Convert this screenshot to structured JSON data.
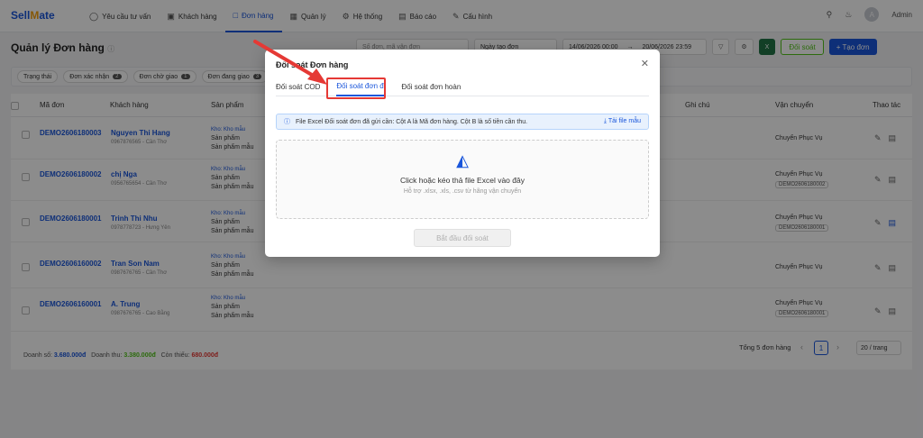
{
  "brand": {
    "logo_a": "Sell",
    "logo_b": "M",
    "logo_c": "ate"
  },
  "nav": [
    {
      "label": "Yêu cầu tư vấn",
      "icon": "chat-icon"
    },
    {
      "label": "Khách hàng",
      "icon": "users-icon"
    },
    {
      "label": "Đơn hàng",
      "icon": "cart-icon",
      "active": true
    },
    {
      "label": "Quản lý",
      "icon": "grid-icon"
    },
    {
      "label": "Hệ thống",
      "icon": "gear-icon"
    },
    {
      "label": "Báo cáo",
      "icon": "report-icon"
    },
    {
      "label": "Cấu hình",
      "icon": "wrench-icon"
    }
  ],
  "user": {
    "name": "Admin",
    "initial": "A"
  },
  "page": {
    "title": "Quản lý Đơn hàng"
  },
  "toolbar": {
    "search_placeholder": "Số đơn, mã vận đơn",
    "date_type": "Ngày tạo đơn",
    "date_from": "14/06/2026 00:00",
    "date_to": "20/06/2026 23:59",
    "reconcile": "Đối soát",
    "create": "+ Tạo đơn"
  },
  "filters": [
    {
      "label": "Trạng thái"
    },
    {
      "label": "Đơn xác nhận",
      "count": "2"
    },
    {
      "label": "Đơn chờ giao",
      "count": "1"
    },
    {
      "label": "Đơn đang giao",
      "count": "3"
    }
  ],
  "table": {
    "headers": {
      "code": "Mã đơn",
      "customer": "Khách hàng",
      "product": "Sản phẩm",
      "note": "Ghi chú",
      "shipping": "Vận chuyển",
      "actions": "Thao tác"
    },
    "rows": [
      {
        "code": "DEMO2606180003",
        "customer": "Nguyen Thi Hang",
        "phone": "0967876565 - Cần Thơ",
        "p1": "Kho: Kho mẫu",
        "p2": "Sản phẩm",
        "p3": "Sản phẩm mẫu",
        "ship": "Chuyển Phục Vụ",
        "tracking": ""
      },
      {
        "code": "DEMO2606180002",
        "customer": "chị Nga",
        "phone": "0956765654 - Cần Thơ",
        "p1": "Kho: Kho mẫu",
        "p2": "Sản phẩm",
        "p3": "Sản phẩm mẫu",
        "ship": "Chuyển Phục Vụ",
        "tracking": "DEMO2606180002"
      },
      {
        "code": "DEMO2606180001",
        "customer": "Trinh Thi Nhu",
        "phone": "0978778723 - Hưng Yên",
        "p1": "Kho: Kho mẫu",
        "p2": "Sản phẩm",
        "p3": "Sản phẩm mẫu",
        "ship": "Chuyển Phục Vụ",
        "tracking": "DEMO2606180001"
      },
      {
        "code": "DEMO2606160002",
        "customer": "Tran Son Nam",
        "phone": "0987676765 - Cần Thơ",
        "p1": "Kho: Kho mẫu",
        "p2": "Sản phẩm",
        "p3": "Sản phẩm mẫu",
        "ship": "Chuyển Phục Vụ",
        "tracking": ""
      },
      {
        "code": "DEMO2606160001",
        "customer": "A. Trung",
        "phone": "0987676765 - Cao Bằng",
        "p1": "Kho: Kho mẫu",
        "p2": "Sản phẩm",
        "p3": "Sản phẩm mẫu",
        "ship": "Chuyển Phục Vụ",
        "tracking": "DEMO2606180001"
      }
    ]
  },
  "footer": {
    "revenue_label": "Doanh số:",
    "revenue": "3.680.000đ",
    "income_label": "Doanh thu:",
    "income": "3.380.000đ",
    "missing_label": "Còn thiếu:",
    "missing": "680.000đ",
    "total": "Tổng 5 đơn hàng",
    "page": "1",
    "per_page": "20 / trang"
  },
  "modal": {
    "title": "Đối soát Đơn hàng",
    "tabs": [
      {
        "label": "Đối soát COD"
      },
      {
        "label": "Đối soát đơn đi",
        "active": true
      },
      {
        "label": "Đối soát đơn hoàn"
      }
    ],
    "info": "File Excel Đối soát đơn đã gửi cần: Cột A là Mã đơn hàng. Cột B là số tiền cần thu.",
    "download": "Tải file mẫu",
    "drop_title": "Click hoặc kéo thả file Excel vào đây",
    "drop_sub": "Hỗ trợ .xlsx, .xls, .csv từ hãng vận chuyển",
    "start": "Bắt đầu đối soát"
  },
  "colors": {
    "accent": "#1a56db",
    "highlight": "#e53935"
  }
}
